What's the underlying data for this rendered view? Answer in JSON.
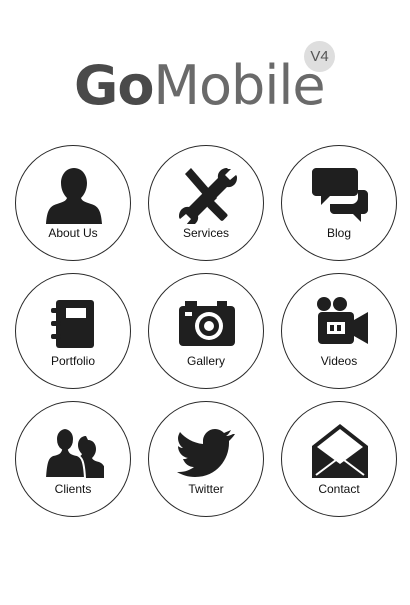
{
  "header": {
    "logo_bold": "Go",
    "logo_light": "Mobile",
    "version": "V4"
  },
  "menu": {
    "items": [
      {
        "label": "About Us",
        "icon": "person-icon"
      },
      {
        "label": "Services",
        "icon": "tools-icon"
      },
      {
        "label": "Blog",
        "icon": "chat-bubbles-icon"
      },
      {
        "label": "Portfolio",
        "icon": "notebook-icon"
      },
      {
        "label": "Gallery",
        "icon": "camera-icon"
      },
      {
        "label": "Videos",
        "icon": "video-camera-icon"
      },
      {
        "label": "Clients",
        "icon": "people-icon"
      },
      {
        "label": "Twitter",
        "icon": "twitter-bird-icon"
      },
      {
        "label": "Contact",
        "icon": "envelope-icon"
      }
    ]
  }
}
